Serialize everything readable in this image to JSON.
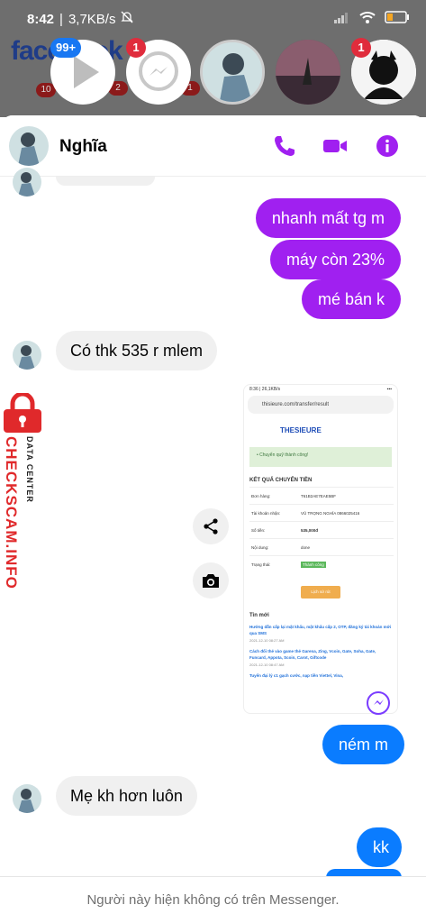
{
  "status_bar": {
    "time": "8:42",
    "speed": "3,7KB/s"
  },
  "background": {
    "logo": "facebook",
    "badges": [
      "10",
      "2",
      "1"
    ]
  },
  "chat_heads": [
    {
      "name": "video-head",
      "badge": "99+"
    },
    {
      "name": "messenger-head",
      "badge": "1"
    },
    {
      "name": "nghia-head",
      "badge": ""
    },
    {
      "name": "sunset-head",
      "badge": ""
    },
    {
      "name": "dark-head",
      "badge": "1"
    }
  ],
  "chat_header": {
    "name": "Nghĩa"
  },
  "messages": {
    "out_1": "nhanh mất tg m",
    "out_2": "máy còn 23%",
    "out_3": "mé bán k",
    "in_1": "Có thk 535 r mlem",
    "out_4": "ném m",
    "in_2": "Mẹ kh hơn luôn",
    "out_5": "kk"
  },
  "shot": {
    "time": "8:36 | 26,1KB/s",
    "url": "thisieure.com/transfer/result",
    "logo": "THESIEURE",
    "success": "• Chuyển quỹ thành công!",
    "title": "KẾT QUẢ CHUYỂN TIỀN",
    "rows": [
      {
        "k": "Đơn hàng:",
        "v": "T61B2AE7EAE5BF"
      },
      {
        "k": "Tài khoản nhận:",
        "v": "VŨ TRỌNG NGHĨA 0866025416"
      },
      {
        "k": "Số tiền:",
        "v": "535,000đ"
      },
      {
        "k": "Nội dung:",
        "v": "done"
      },
      {
        "k": "Trạng thái:",
        "v": "Thành công"
      }
    ],
    "button": "Lịch sử rút",
    "news_title": "Tin mới",
    "news": [
      {
        "t": "Hướng dẫn cấp lại mật khẩu, mật khẩu cấp 2, OTP, đăng ký tài khoản mới qua SMS",
        "d": "2021-12-10 08:27 AM"
      },
      {
        "t": "Cách đổi thẻ vào game thẻ Garena, Zing, Vcoin, Gate, Soha, Gate, Funcard, Appota, Scoin, Carot, Giftcode",
        "d": "2021-12-10 08:47 AM"
      },
      {
        "t": "Tuyển đại lý c1 gạch cước, nạp tiền Viettel, Vina,",
        "d": ""
      }
    ]
  },
  "watermark": {
    "main": "CHECKSCAM.INFO",
    "sub": "DATA CENTER"
  },
  "footer": {
    "notice": "Người này hiện không có trên Messenger."
  },
  "colors": {
    "accent": "#a020f0",
    "blue": "#0a7cff"
  }
}
